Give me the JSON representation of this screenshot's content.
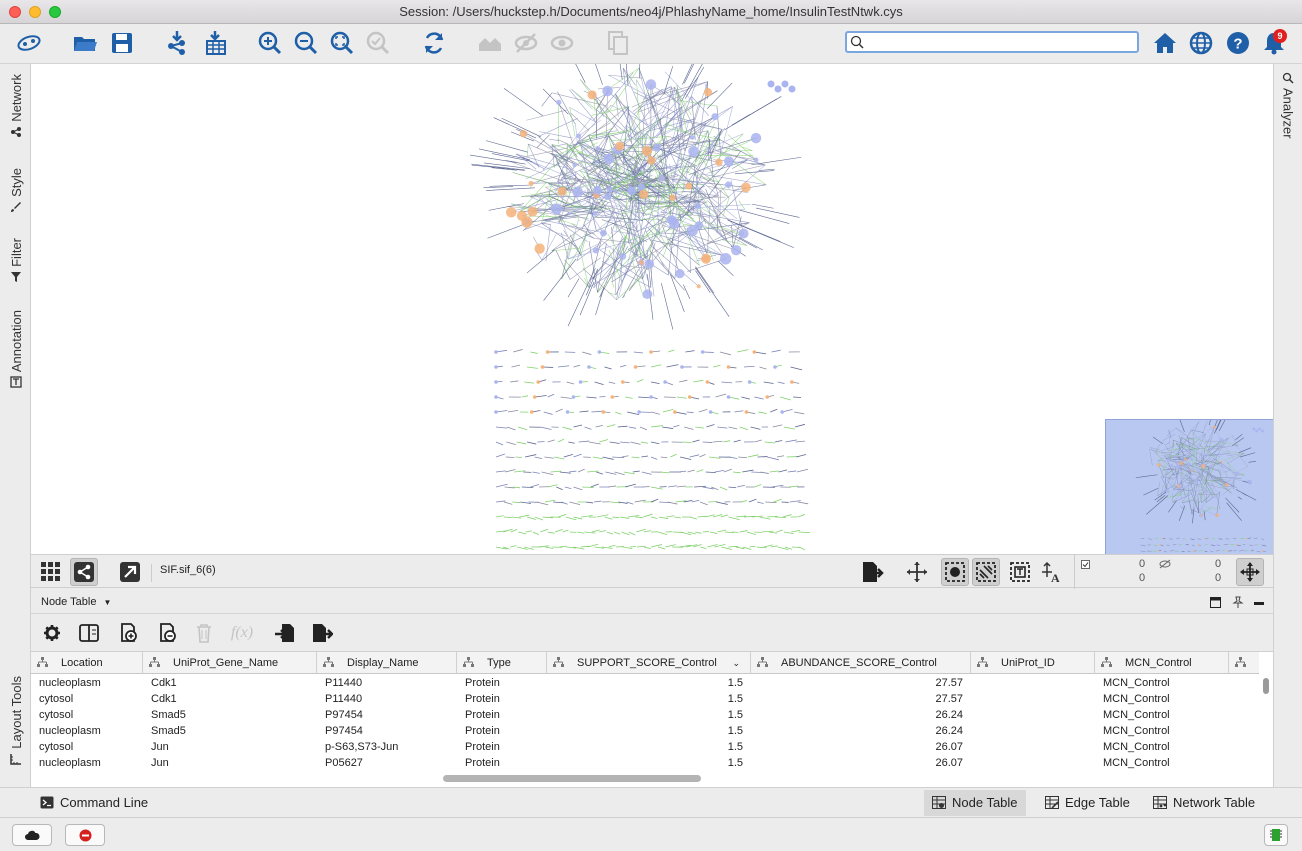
{
  "window": {
    "title": "Session: /Users/huckstep.h/Documents/neo4j/PhlashyName_home/InsulinTestNtwk.cys"
  },
  "toolbar": {
    "search_value": "",
    "notification_count": "9"
  },
  "left_panel": {
    "tabs": [
      "Network",
      "Style",
      "Filter",
      "Annotation"
    ],
    "bottom_tab": "Layout Tools"
  },
  "right_panel": {
    "tabs": [
      "Analyzer"
    ]
  },
  "network_toolbar": {
    "network_name": "SIF.sif_6(6)"
  },
  "overview_stats": {
    "selected_nodes": "0",
    "selected_edges": "0",
    "hidden_nodes": "0",
    "hidden_edges": "0"
  },
  "table_panel": {
    "title": "Node Table",
    "columns": [
      "Location",
      "UniProt_Gene_Name",
      "Display_Name",
      "Type",
      "SUPPORT_SCORE_Control",
      "ABUNDANCE_SCORE_Control",
      "UniProt_ID",
      "MCN_Control"
    ],
    "rows": [
      [
        "nucleoplasm",
        "Cdk1",
        "P11440",
        "Protein",
        "1.5",
        "27.57",
        "",
        "MCN_Control"
      ],
      [
        "cytosol",
        "Cdk1",
        "P11440",
        "Protein",
        "1.5",
        "27.57",
        "",
        "MCN_Control"
      ],
      [
        "cytosol",
        "Smad5",
        "P97454",
        "Protein",
        "1.5",
        "26.24",
        "",
        "MCN_Control"
      ],
      [
        "nucleoplasm",
        "Smad5",
        "P97454",
        "Protein",
        "1.5",
        "26.24",
        "",
        "MCN_Control"
      ],
      [
        "cytosol",
        "Jun",
        "p-S63,S73-Jun",
        "Protein",
        "1.5",
        "26.07",
        "",
        "MCN_Control"
      ],
      [
        "nucleoplasm",
        "Jun",
        "P05627",
        "Protein",
        "1.5",
        "26.07",
        "",
        "MCN_Control"
      ]
    ]
  },
  "bottom_tabs": {
    "command_line": "Command Line",
    "node_table": "Node Table",
    "edge_table": "Edge Table",
    "network_table": "Network Table"
  },
  "colors": {
    "accent": "#1f5fa8",
    "node_blue": "#aab4f0",
    "node_orange": "#f5b27a",
    "edge_green": "#7fd16a",
    "overview_bg": "#b9c8f0",
    "notif_red": "#e02020"
  }
}
